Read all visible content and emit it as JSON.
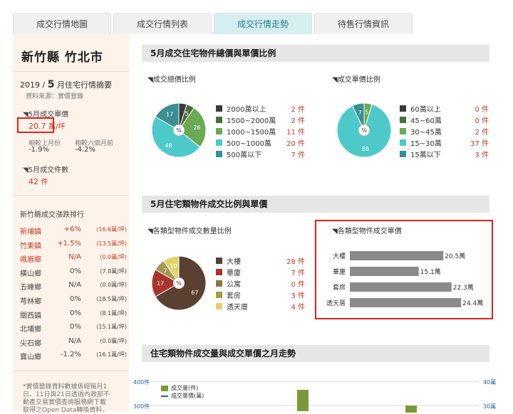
{
  "tabs": [
    "成交行情地圖",
    "成交行情列表",
    "成交行情走勢",
    "待售行情資訊"
  ],
  "side": {
    "city": "新竹縣 竹北市",
    "summary_year": "2019 /",
    "summary_month": "5",
    "summary_tail": "月住宅行情摘要",
    "source": "資料來源：實價登錄",
    "unit_price_label": "5月成交單價",
    "unit_price_value": "20.7",
    "unit_price_unit": "萬/坪",
    "cmp_prev_label": "相較上月份",
    "cmp_prev_value": "-1.9%",
    "cmp_six_label": "相較六個月前",
    "cmp_six_value": "-4.2%",
    "count_label": "5月成交件數",
    "count_value": "42",
    "count_unit": "件",
    "rank_title": "新竹縣成交漲跌排行",
    "ranks": [
      {
        "name": "新埔鎮",
        "pct": "+6%",
        "price": "(16.6萬/坪)",
        "hot": true
      },
      {
        "name": "竹東鎮",
        "pct": "+1.5%",
        "price": "(13.5萬/坪)",
        "hot": true
      },
      {
        "name": "峨眉鄉",
        "pct": "N/A",
        "price": "(0.0萬/坪)",
        "hot": true
      },
      {
        "name": "橫山鄉",
        "pct": "0%",
        "price": "(7.8萬/坪)",
        "hot": false
      },
      {
        "name": "五峰鄉",
        "pct": "N/A",
        "price": "(0.0萬/坪)",
        "hot": false
      },
      {
        "name": "芎林鄉",
        "pct": "0%",
        "price": "(18.5萬/坪)",
        "hot": false
      },
      {
        "name": "關西鎮",
        "pct": "0%",
        "price": "(8.1萬/坪)",
        "hot": false
      },
      {
        "name": "北埔鄉",
        "pct": "0%",
        "price": "(15.1萬/坪)",
        "hot": false
      },
      {
        "name": "尖石鄉",
        "pct": "N/A",
        "price": "(0.0萬/坪)",
        "hot": false
      },
      {
        "name": "寶山鄉",
        "pct": "-1.2%",
        "price": "(16.1萬/坪)",
        "hot": false
      }
    ],
    "note1": "*實價登錄資料數據係經每月1",
    "note2": "日、11日與21日透過內政部不",
    "note3": "動產交易實價查詢服務網下載",
    "note4": "取得之Open Data轉換資料，"
  },
  "sec1": {
    "title": "5月成交住宅物件總價與單價比例",
    "total_title": "成交總價比例",
    "unit_title": "成交單價比例",
    "total_legend": [
      {
        "label": "2000萬以上",
        "value": "2 件",
        "color": "#3a3a3a"
      },
      {
        "label": "1500~2000萬",
        "value": "2 件",
        "color": "#4f6b3c"
      },
      {
        "label": "1000~1500萬",
        "value": "11 件",
        "color": "#6aaa52"
      },
      {
        "label": "500~1000萬",
        "value": "20 件",
        "color": "#4ec9c9"
      },
      {
        "label": "500萬以下",
        "value": "7 件",
        "color": "#3a8f92"
      }
    ],
    "total_pie": [
      2,
      2,
      11,
      20,
      7
    ],
    "total_pie_labels": [
      "",
      "5",
      "26",
      "48",
      "17"
    ],
    "unit_legend": [
      {
        "label": "60萬以上",
        "value": "0 件",
        "color": "#3a3a3a"
      },
      {
        "label": "45~60萬",
        "value": "0 件",
        "color": "#4f6b3c"
      },
      {
        "label": "30~45萬",
        "value": "2 件",
        "color": "#6aaa52"
      },
      {
        "label": "15~30萬",
        "value": "37 件",
        "color": "#4ec9c9"
      },
      {
        "label": "15萬以下",
        "value": "3 件",
        "color": "#3a8f92"
      }
    ],
    "unit_pie": [
      0,
      0,
      2,
      37,
      3
    ],
    "unit_pie_labels": [
      "",
      "",
      "5",
      "88",
      "7"
    ]
  },
  "sec2": {
    "title": "5月住宅類物件成交比例與單價",
    "count_title": "各類型物件成交數量比例",
    "price_title": "各類型物件成交單價",
    "legend": [
      {
        "label": "大樓",
        "value": "28 件",
        "color": "#5a4030"
      },
      {
        "label": "華廈",
        "value": "7 件",
        "color": "#a8342c"
      },
      {
        "label": "公寓",
        "value": "0 件",
        "color": "#8a7a40"
      },
      {
        "label": "套房",
        "value": "3 件",
        "color": "#a09a50"
      },
      {
        "label": "透天厝",
        "value": "4 件",
        "color": "#e0d46a"
      }
    ],
    "pie": [
      28,
      7,
      0,
      3,
      4
    ],
    "pie_labels": [
      "67",
      "17",
      "",
      "7",
      "10"
    ],
    "bars": [
      {
        "label": "大樓",
        "value": 20.5,
        "text": "20.5萬"
      },
      {
        "label": "華廈",
        "value": 15.1,
        "text": "15.1萬"
      },
      {
        "label": "套房",
        "value": 22.3,
        "text": "22.3萬"
      },
      {
        "label": "透天厝",
        "value": 24.4,
        "text": "24.4萬"
      }
    ]
  },
  "sec3": {
    "title": "住宅類物件成交量與成交單價之月走勢",
    "y_left_top": "400件",
    "y_left_mid": "300件",
    "y_right_top": "40萬",
    "y_right_mid": "30萬",
    "legend_vol": "成交量(件)",
    "legend_price": "成交單價(萬)"
  },
  "pct_symbol": "%"
}
